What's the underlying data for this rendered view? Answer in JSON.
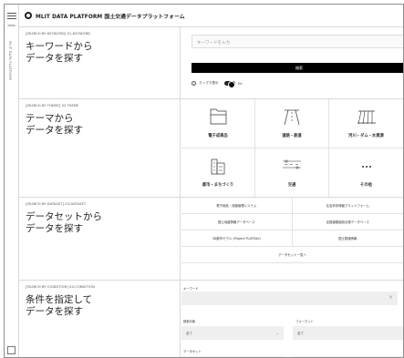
{
  "rail": {
    "menu_label": "MENU",
    "vertical_text": "MLIT DATA PLATFORM"
  },
  "header": {
    "title": "MLIT DATA PLATFORM 国土交通データプラットフォーム"
  },
  "keyword": {
    "tag": "[SEARCH BY KEYWORD] 01-KEYWORD",
    "heading_line1": "キーワードから",
    "heading_line2": "データを探す",
    "placeholder": "キーワードを入力",
    "search_button": "検索",
    "map_label": "マップで表示",
    "toggle_label": "On"
  },
  "theme": {
    "tag": "[SEARCH BY THEME] 02-THEME",
    "heading_line1": "テーマから",
    "heading_line2": "データを探す",
    "items": [
      {
        "label": "電子成果品",
        "icon": "folder-icon"
      },
      {
        "label": "道路・鉄道",
        "icon": "road-icon"
      },
      {
        "label": "河川・ダム・水資源",
        "icon": "river-icon"
      },
      {
        "label": "都市・まちづくり",
        "icon": "city-icon"
      },
      {
        "label": "交通",
        "icon": "traffic-icon"
      },
      {
        "label": "その他",
        "icon": "more-icon"
      }
    ]
  },
  "dataset": {
    "tag": "[SEARCH BY DATASET] 03-DATASET",
    "heading_line1": "データセットから",
    "heading_line2": "データを探す",
    "items": [
      "電子納品・保管管理システム",
      "社会資本情報プラットフォーム",
      "国土地盤情報データベース",
      "全国道路施設点検データベース",
      "3D都市モデル (Project PLATEAU)",
      "国土数値情報",
      "データセット一覧へ"
    ]
  },
  "condition": {
    "tag": "[SEARCH BY CONDITION] 04-CONDITION",
    "heading_line1": "条件を指定して",
    "heading_line2": "データを探す",
    "keyword_label": "キーワード",
    "left_select_label": "検索対象",
    "left_select_value": "全て",
    "right_select_label": "フォーマット",
    "right_select_value": "全て",
    "bottom_label": "データセット"
  },
  "colors": {
    "primary_button": "#000000",
    "border": "#d8d8d8",
    "input_bg": "#efefef"
  }
}
